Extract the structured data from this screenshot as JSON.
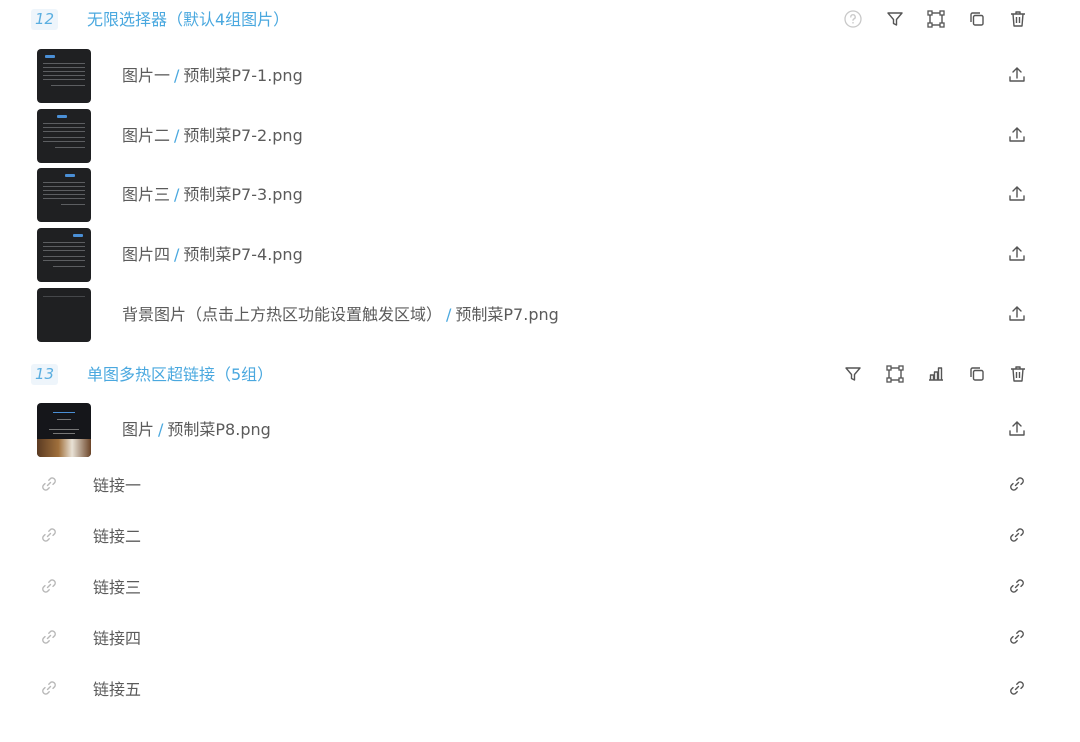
{
  "sections": [
    {
      "number": "12",
      "title": "无限选择器（默认4组图片）",
      "toolbar": [
        "help-icon",
        "filter-icon",
        "hotspot-frame-icon",
        "copy-icon",
        "delete-icon"
      ],
      "images": [
        {
          "name": "图片一",
          "file": "预制菜P7-1.png"
        },
        {
          "name": "图片二",
          "file": "预制菜P7-2.png"
        },
        {
          "name": "图片三",
          "file": "预制菜P7-3.png"
        },
        {
          "name": "图片四",
          "file": "预制菜P7-4.png"
        },
        {
          "name": "背景图片（点击上方热区功能设置触发区域）",
          "file": "预制菜P7.png"
        }
      ]
    },
    {
      "number": "13",
      "title": "单图多热区超链接（5组）",
      "toolbar": [
        "filter-icon",
        "hotspot-frame-icon",
        "chart-icon",
        "copy-icon",
        "delete-icon"
      ],
      "images": [
        {
          "name": "图片",
          "file": "预制菜P8.png"
        }
      ],
      "links": [
        "链接一",
        "链接二",
        "链接三",
        "链接四",
        "链接五"
      ]
    }
  ],
  "separator": "/",
  "colors": {
    "accent": "#4aa8df",
    "badge_bg": "#eef5fb",
    "text": "#5b5b5b",
    "icon": "#555555",
    "icon_light": "#c8c8c8"
  }
}
